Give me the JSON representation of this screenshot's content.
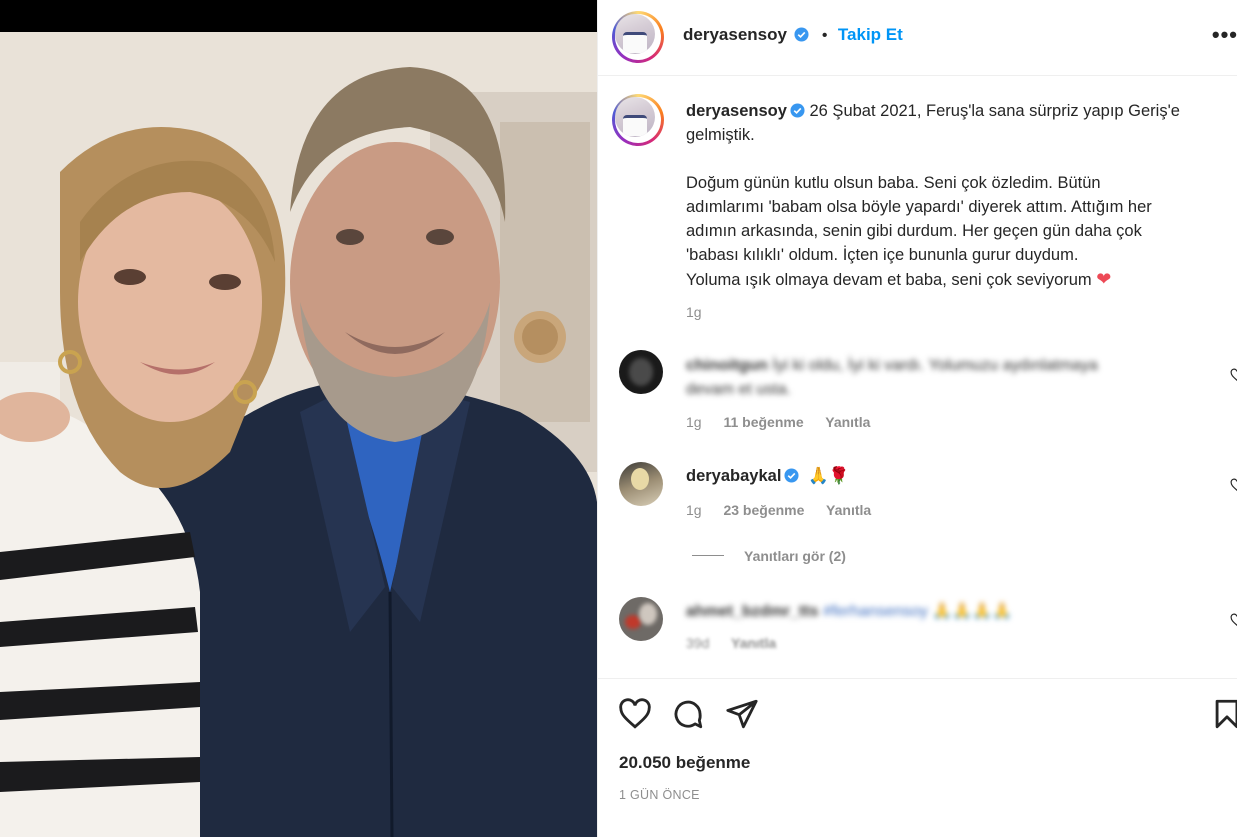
{
  "post": {
    "username": "deryasensoy",
    "follow_label": "Takip Et",
    "follow_separator": "•",
    "more_label": "•••"
  },
  "caption": {
    "username": "deryasensoy",
    "line1": "26 Şubat 2021, Feruş'la sana sürpriz yapıp Geriş'e",
    "line2": "gelmiştik.",
    "body_lines": [
      "Doğum günün kutlu olsun baba. Seni çok özledim. Bütün",
      "adımlarımı 'babam olsa böyle yapardı' diyerek attım. Attığım her",
      "adımın arkasında, senin gibi durdum. Her geçen gün daha çok",
      "'babası kılıklı' oldum. İçten içe bununla gurur duydum.",
      "Yoluma ışık olmaya devam et baba, seni çok seviyorum"
    ],
    "heart_emoji": "❤",
    "age": "1g"
  },
  "comments": [
    {
      "username": "chinoitgun",
      "text_line1": "İyi ki oldu, İyi ki vardı. Yolumuzu aydınlatmaya",
      "text_line2": "devam et usta.",
      "age": "1g",
      "likes": "11 beğenme",
      "reply": "Yanıtla",
      "blurred": true
    },
    {
      "username": "deryabaykal",
      "text": "🙏🌹",
      "age": "1g",
      "likes": "23 beğenme",
      "reply": "Yanıtla",
      "view_replies": "Yanıtları gör (2)"
    },
    {
      "username": "ahmet_bzdmr_tts",
      "text": "#ferhansensoy 🙏🙏🙏🙏",
      "age": "39d",
      "reply": "Yanıtla",
      "blurred": true
    }
  ],
  "footer": {
    "likes": "20.050 beğenme",
    "time": "1 GÜN ÖNCE"
  },
  "colors": {
    "accent": "#0095f6",
    "text": "#262626",
    "secondary": "#8e8e8e",
    "heart": "#ed4956"
  },
  "icons": [
    "verified-icon",
    "like-icon",
    "comment-icon",
    "share-icon",
    "save-icon",
    "more-icon"
  ]
}
